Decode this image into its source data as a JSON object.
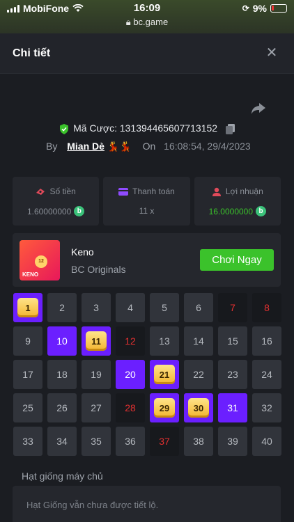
{
  "status_bar": {
    "carrier": "MobiFone",
    "time": "16:09",
    "url": "bc.game",
    "battery": "9%"
  },
  "header": {
    "title": "Chi tiết",
    "close_icon": "close-icon"
  },
  "bet": {
    "id_label": "Mã Cược:",
    "id_value": "131394465607713152",
    "by_label": "By",
    "user": "Mian Dè",
    "user_emoji": "💃💃",
    "on_label": "On",
    "datetime": "16:08:54, 29/4/2023"
  },
  "stats": [
    {
      "label": "Số tiền",
      "value": "1.60000000",
      "icon": "money-icon",
      "coin": "b"
    },
    {
      "label": "Thanh toán",
      "value": "11 x",
      "icon": "card-icon",
      "coin": ""
    },
    {
      "label": "Lợi nhuận",
      "value": "16.0000000",
      "icon": "profit-icon",
      "coin": "b"
    }
  ],
  "game": {
    "name": "Keno",
    "provider": "BC Originals",
    "play_label": "Chơi Ngay",
    "thumb_text": "KENO",
    "thumb_ball": "12"
  },
  "keno": {
    "cells": [
      {
        "n": "1",
        "state": "win"
      },
      {
        "n": "2",
        "state": "normal"
      },
      {
        "n": "3",
        "state": "normal"
      },
      {
        "n": "4",
        "state": "normal"
      },
      {
        "n": "5",
        "state": "normal"
      },
      {
        "n": "6",
        "state": "normal"
      },
      {
        "n": "7",
        "state": "drawn"
      },
      {
        "n": "8",
        "state": "drawn"
      },
      {
        "n": "9",
        "state": "normal"
      },
      {
        "n": "10",
        "state": "picked"
      },
      {
        "n": "11",
        "state": "win"
      },
      {
        "n": "12",
        "state": "drawn"
      },
      {
        "n": "13",
        "state": "normal"
      },
      {
        "n": "14",
        "state": "normal"
      },
      {
        "n": "15",
        "state": "normal"
      },
      {
        "n": "16",
        "state": "normal"
      },
      {
        "n": "17",
        "state": "normal"
      },
      {
        "n": "18",
        "state": "normal"
      },
      {
        "n": "19",
        "state": "normal"
      },
      {
        "n": "20",
        "state": "picked"
      },
      {
        "n": "21",
        "state": "win"
      },
      {
        "n": "22",
        "state": "normal"
      },
      {
        "n": "23",
        "state": "normal"
      },
      {
        "n": "24",
        "state": "normal"
      },
      {
        "n": "25",
        "state": "normal"
      },
      {
        "n": "26",
        "state": "normal"
      },
      {
        "n": "27",
        "state": "normal"
      },
      {
        "n": "28",
        "state": "drawn"
      },
      {
        "n": "29",
        "state": "win"
      },
      {
        "n": "30",
        "state": "win"
      },
      {
        "n": "31",
        "state": "picked"
      },
      {
        "n": "32",
        "state": "normal"
      },
      {
        "n": "33",
        "state": "normal"
      },
      {
        "n": "34",
        "state": "normal"
      },
      {
        "n": "35",
        "state": "normal"
      },
      {
        "n": "36",
        "state": "normal"
      },
      {
        "n": "37",
        "state": "drawn"
      },
      {
        "n": "38",
        "state": "normal"
      },
      {
        "n": "39",
        "state": "normal"
      },
      {
        "n": "40",
        "state": "normal"
      }
    ]
  },
  "seed": {
    "label": "Hạt giống máy chủ",
    "value": "Hạt Giống vẫn chưa được tiết lộ."
  },
  "colors": {
    "accent_green": "#3bc22b",
    "picked_purple": "#6b1fff",
    "drawn_red": "#e23030"
  }
}
